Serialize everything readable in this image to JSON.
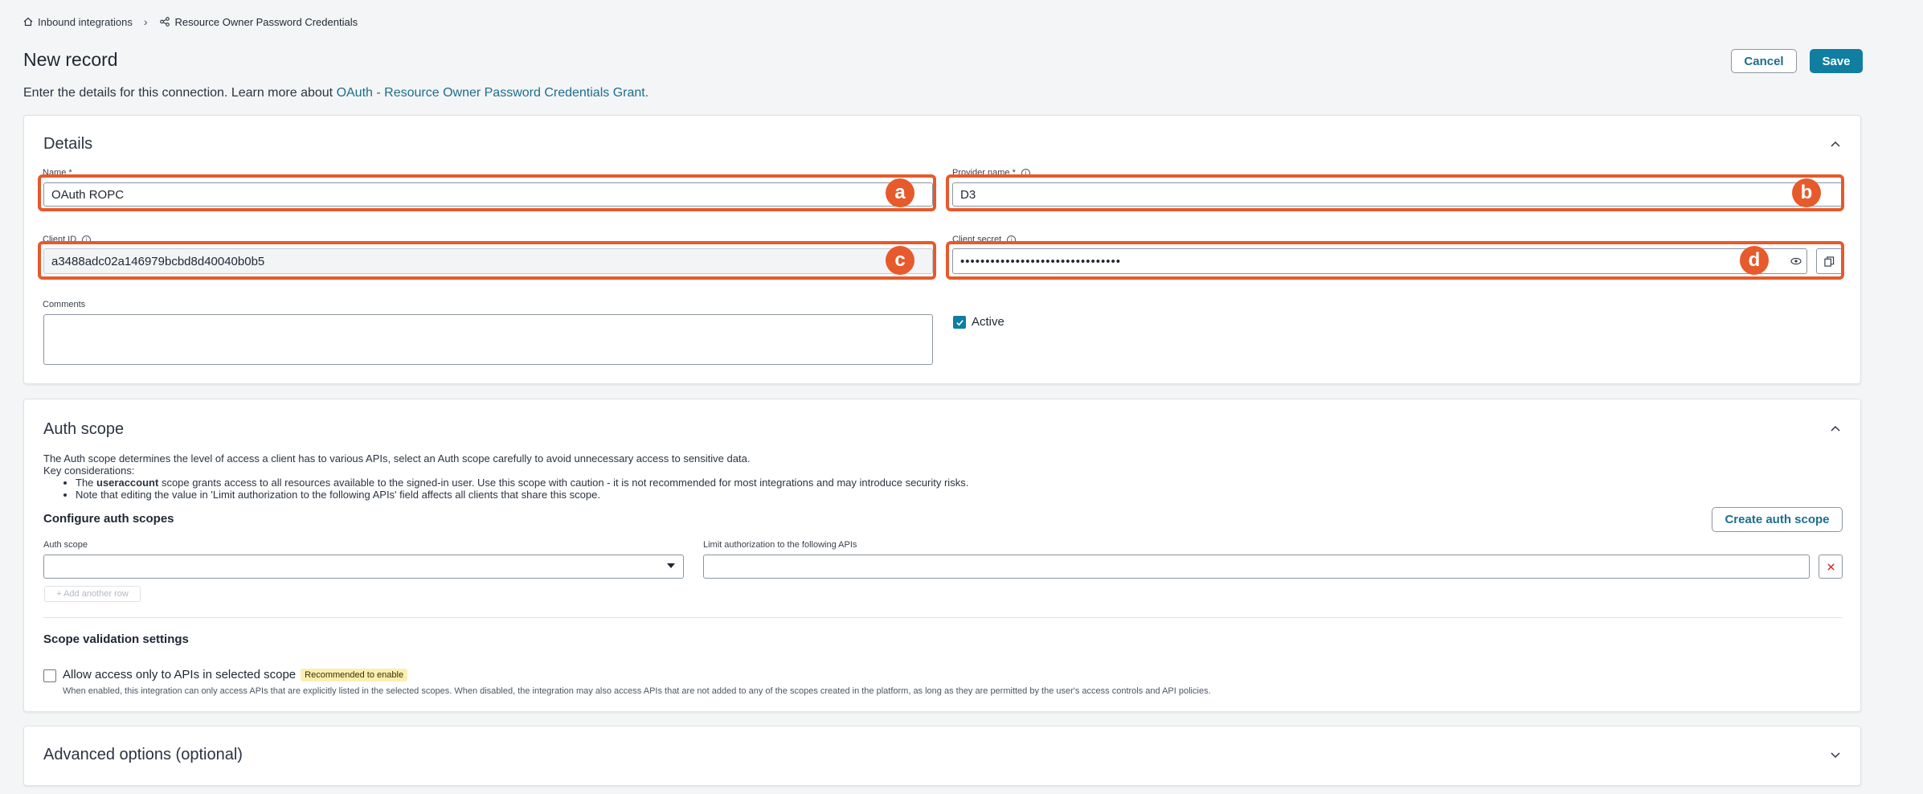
{
  "breadcrumb": {
    "parent": "Inbound integrations",
    "current": "Resource Owner Password Credentials"
  },
  "header": {
    "title": "New record",
    "cancel_label": "Cancel",
    "save_label": "Save",
    "intro_text": "Enter the details for this connection. Learn more about ",
    "intro_link": "OAuth - Resource Owner Password Credentials Grant."
  },
  "details": {
    "title": "Details",
    "name_label": "Name",
    "name_required": "*",
    "name_value": "OAuth ROPC",
    "provider_label": "Provider name",
    "provider_required": "*",
    "provider_value": "D3",
    "client_id_label": "Client ID",
    "client_id_value": "a3488adc02a146979bcbd8d40040b0b5",
    "client_secret_label": "Client secret",
    "client_secret_value": "••••••••••••••••••••••••••••••••",
    "comments_label": "Comments",
    "comments_value": "",
    "active_label": "Active",
    "active_checked": true
  },
  "markers": {
    "a": "a",
    "b": "b",
    "c": "c",
    "d": "d"
  },
  "auth_scope": {
    "title": "Auth scope",
    "description": "The Auth scope determines the level of access a client has to various APIs, select an Auth scope carefully to avoid unnecessary access to sensitive data.",
    "key_considerations": "Key considerations:",
    "bullet1_prefix": "The ",
    "bullet1_bold": "useraccount",
    "bullet1_suffix": " scope grants access to all resources available to the signed-in user. Use this scope with caution - it is not recommended for most integrations and may introduce security risks.",
    "bullet2": "Note that editing the value in 'Limit authorization to the following APIs' field affects all clients that share this scope.",
    "configure_heading": "Configure auth scopes",
    "create_button": "Create auth scope",
    "auth_scope_label": "Auth scope",
    "auth_scope_value": "",
    "limit_label": "Limit authorization to the following APIs",
    "limit_value": "",
    "add_row_label": "+ Add another row",
    "scope_validation_heading": "Scope validation settings",
    "allow_label": "Allow access only to APIs in selected scope",
    "recommended_badge": "Recommended to enable",
    "allow_help": "When enabled, this integration can only access APIs that are explicitly listed in the selected scopes. When disabled, the integration may also access APIs that are not added to any of the scopes created in the platform, as long as they are permitted by the user's access controls and API policies."
  },
  "advanced": {
    "title": "Advanced options (optional)"
  },
  "colors": {
    "accent": "#0f7ea0",
    "link": "#1c6e8c",
    "marker": "#e65a2c",
    "badge_bg": "#fbefb0"
  },
  "icons": [
    "home-icon",
    "chevron-right-icon",
    "integration-icon",
    "chevron-up-icon",
    "chevron-down-icon",
    "info-icon",
    "eye-icon",
    "copy-icon",
    "dropdown-arrow-icon",
    "remove-icon",
    "checkmark-icon"
  ]
}
